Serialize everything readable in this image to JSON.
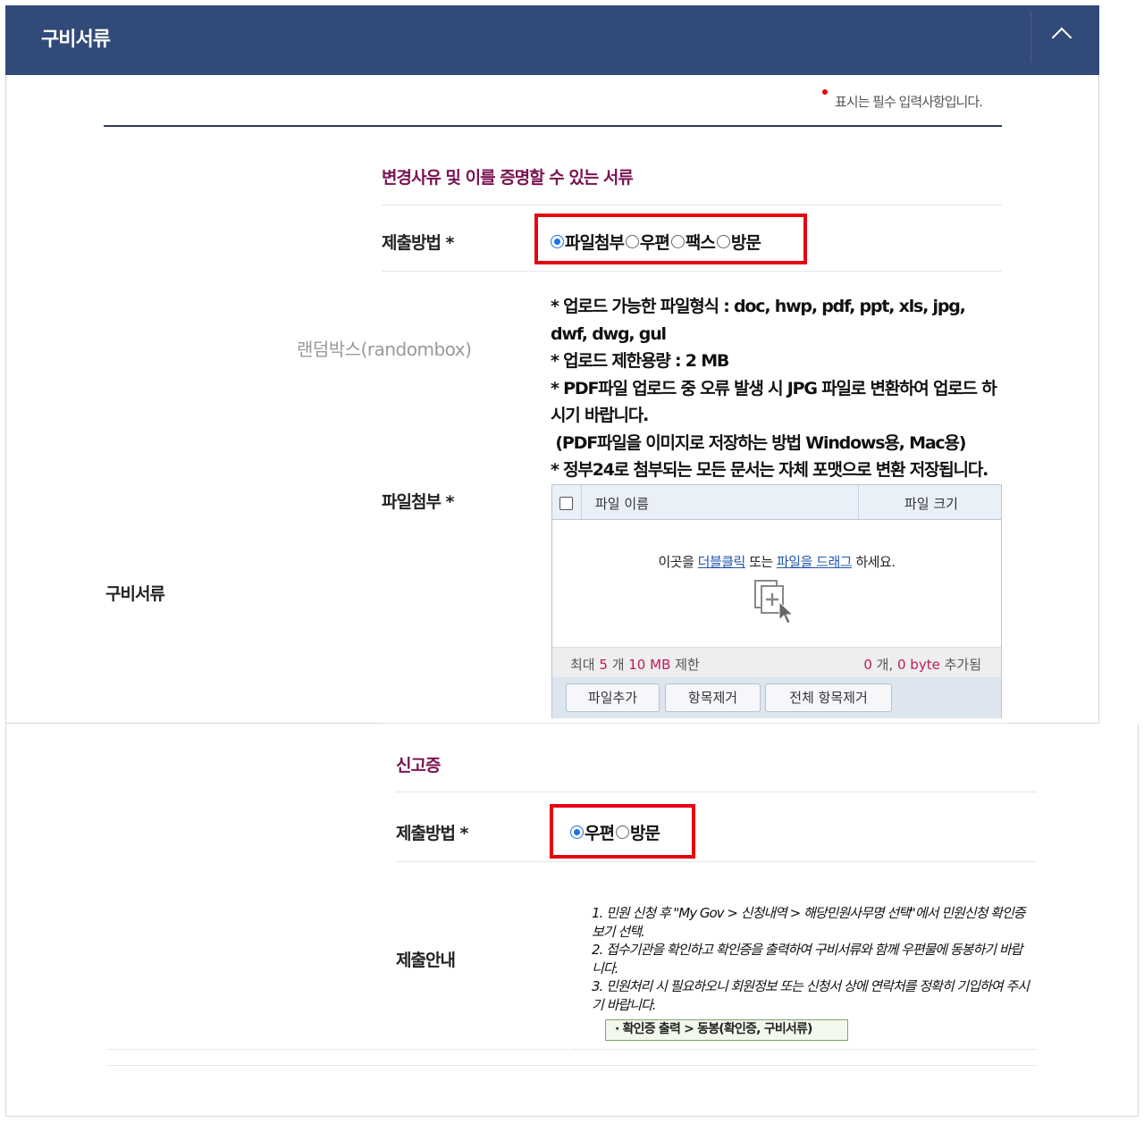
{
  "header": {
    "title": "구비서류"
  },
  "required_note": "표시는 필수 입력사항입니다.",
  "row_label": "구비서류",
  "randombox_label": "랜덤박스(randombox)",
  "section1": {
    "title": "변경사유 및 이를 증명할 수 있는 서류",
    "method_label": "제출방법 *",
    "methods": [
      {
        "label": "파일첨부",
        "checked": true
      },
      {
        "label": "우편",
        "checked": false
      },
      {
        "label": "팩스",
        "checked": false
      },
      {
        "label": "방문",
        "checked": false
      }
    ],
    "attach_label": "파일첨부 *",
    "notes": [
      "* 업로드 가능한 파일형식 : doc, hwp, pdf, ppt, xls, jpg, dwf, dwg, gul",
      "* 업로드 제한용량 : 2 MB",
      "* PDF파일 업로드 중 오류 발생 시 JPG 파일로 변환하여 업로드 하시기 바랍니다.",
      " (PDF파일을 이미지로 저장하는 방법 Windows용, Mac용)",
      "* 정부24로 첨부되는 모든 문서는 자체 포맷으로 변환 저장됩니다."
    ],
    "uploader": {
      "col_name": "파일 이름",
      "col_size": "파일 크기",
      "drop_prefix": "이곳을 ",
      "drop_link1": "더블클릭",
      "drop_mid": " 또는 ",
      "drop_link2": "파일을 드래그",
      "drop_suffix": " 하세요.",
      "limit_prefix": "최대 ",
      "limit_count": "5",
      "limit_mid": " 개 ",
      "limit_size": "10 MB",
      "limit_suffix": " 제한",
      "added_count": "0",
      "added_mid": " 개, ",
      "added_size": "0 byte",
      "added_suffix": " 추가됨",
      "buttons": [
        "파일추가",
        "항목제거",
        "전체 항목제거"
      ]
    }
  },
  "section2": {
    "title": "신고증",
    "method_label": "제출방법 *",
    "methods": [
      {
        "label": "우편",
        "checked": true
      },
      {
        "label": "방문",
        "checked": false
      }
    ],
    "guide_label": "제출안내",
    "guide_lines": [
      "1. 민원 신청 후 \"My Gov > 신청내역 > 해당민원사무명 선택\"에서 민원신청 확인증보기 선택.",
      "2. 접수기관을 확인하고 확인증을 출력하여 구비서류와 함께 우편물에 동봉하기 바랍니다.",
      "3. 민원처리 시 필요하오니 회원정보 또는 신청서 상에 연락처를 정확히 기입하여 주시기 바랍니다."
    ],
    "guide_button": "· 확인증 출력 > 동봉(확인증, 구비서류)"
  }
}
